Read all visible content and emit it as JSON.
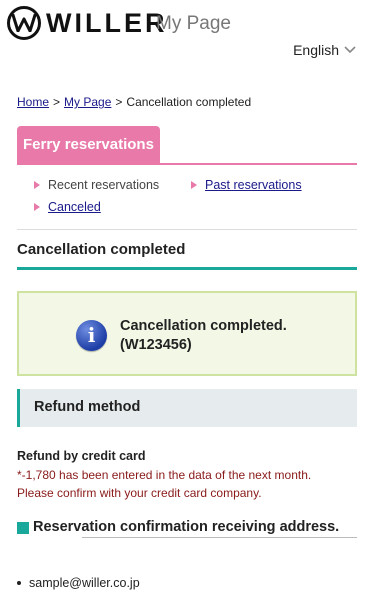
{
  "header": {
    "logo_text": "WILLER",
    "subtitle": "My Page"
  },
  "language": {
    "selected": "English",
    "icon": "chevron-down-icon"
  },
  "breadcrumb": {
    "items": [
      {
        "label": "Home",
        "link": true
      },
      {
        "label": "My Page",
        "link": true
      },
      {
        "label": "Cancellation completed",
        "link": false
      }
    ],
    "separator": ">"
  },
  "tab": {
    "label": "Ferry reservations",
    "color": "#e879a8"
  },
  "subnav": {
    "items": [
      {
        "label": "Recent reservations",
        "link": false
      },
      {
        "label": "Past reservations",
        "link": true
      },
      {
        "label": "Canceled",
        "link": true
      }
    ]
  },
  "page_title": "Cancellation completed",
  "notice": {
    "icon": "info-icon",
    "line1": "Cancellation completed.",
    "line2": "(W123456)"
  },
  "refund": {
    "section_title": "Refund method",
    "method_title": "Refund by credit card",
    "note_line1": "*-1,780 has been entered in the data of the next month.",
    "note_line2": "Please confirm with your credit card company."
  },
  "address": {
    "section_title": "Reservation confirmation receiving address.",
    "email": "sample@willer.co.jp"
  },
  "colors": {
    "accent_teal": "#1aa89a",
    "accent_pink": "#e879a8",
    "note_red": "#8a1a1a",
    "link_blue": "#1a1a8a"
  }
}
